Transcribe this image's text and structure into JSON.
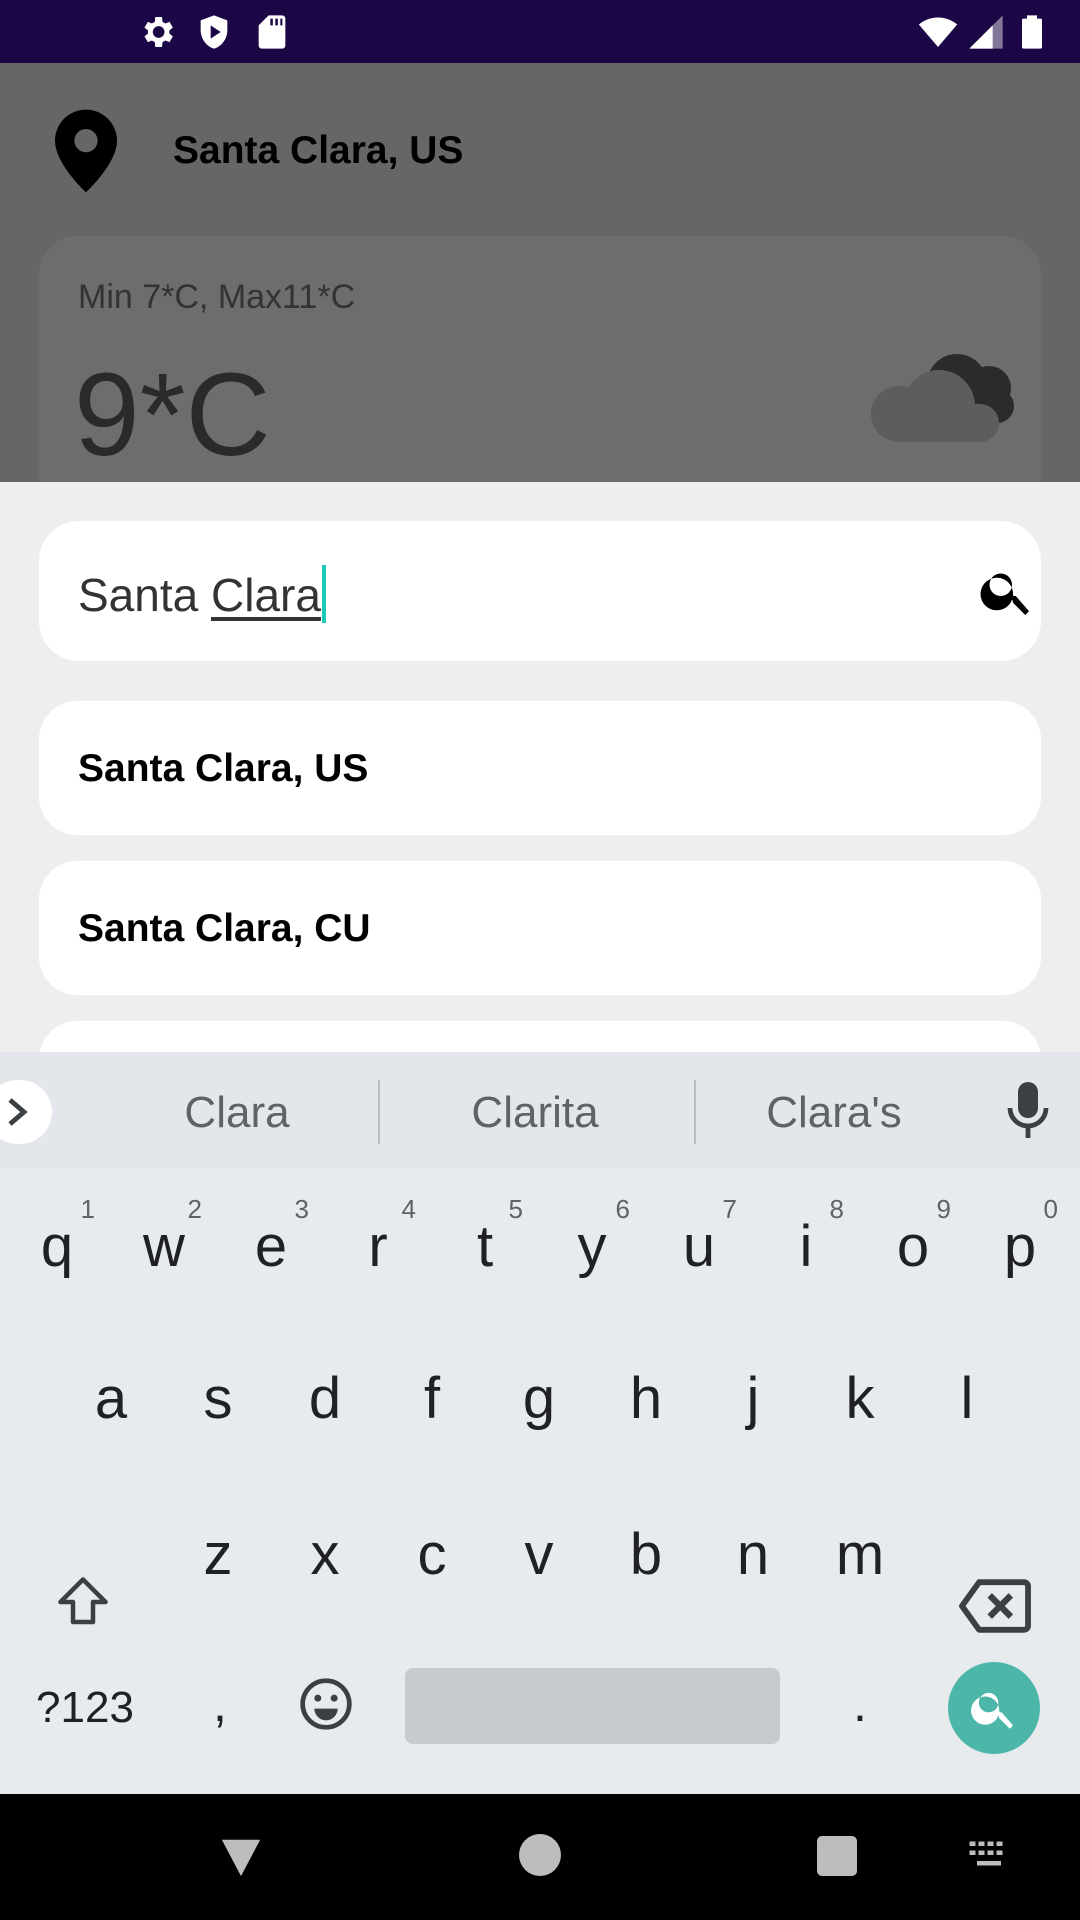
{
  "status_bar": {
    "left_icons": [
      "gear-icon",
      "shield-icon",
      "sd-card-icon"
    ],
    "right_icons": [
      "wifi-icon",
      "signal-icon",
      "battery-icon"
    ]
  },
  "background_app": {
    "location": "Santa Clara, US",
    "minmax": "Min 7*C, Max11*C",
    "temperature": "9*C",
    "weather_icon": "cloud-night-icon"
  },
  "search": {
    "prefix": "Santa ",
    "composing": "Clara",
    "icon": "search-icon"
  },
  "results": [
    {
      "label": "Santa Clara, US"
    },
    {
      "label": "Santa Clara, CU"
    }
  ],
  "keyboard": {
    "suggestions": [
      "Clara",
      "Clarita",
      "Clara's"
    ],
    "row1": [
      {
        "ch": "q",
        "hint": "1"
      },
      {
        "ch": "w",
        "hint": "2"
      },
      {
        "ch": "e",
        "hint": "3"
      },
      {
        "ch": "r",
        "hint": "4"
      },
      {
        "ch": "t",
        "hint": "5"
      },
      {
        "ch": "y",
        "hint": "6"
      },
      {
        "ch": "u",
        "hint": "7"
      },
      {
        "ch": "i",
        "hint": "8"
      },
      {
        "ch": "o",
        "hint": "9"
      },
      {
        "ch": "p",
        "hint": "0"
      }
    ],
    "row2": [
      "a",
      "s",
      "d",
      "f",
      "g",
      "h",
      "j",
      "k",
      "l"
    ],
    "row3": [
      "z",
      "x",
      "c",
      "v",
      "b",
      "n",
      "m"
    ],
    "symbols_label": "?123",
    "comma": ",",
    "period": ".",
    "accent_color": "#4cb6a9"
  },
  "colors": {
    "status_bar": "#1c0746",
    "cursor": "#1ec8b6"
  }
}
